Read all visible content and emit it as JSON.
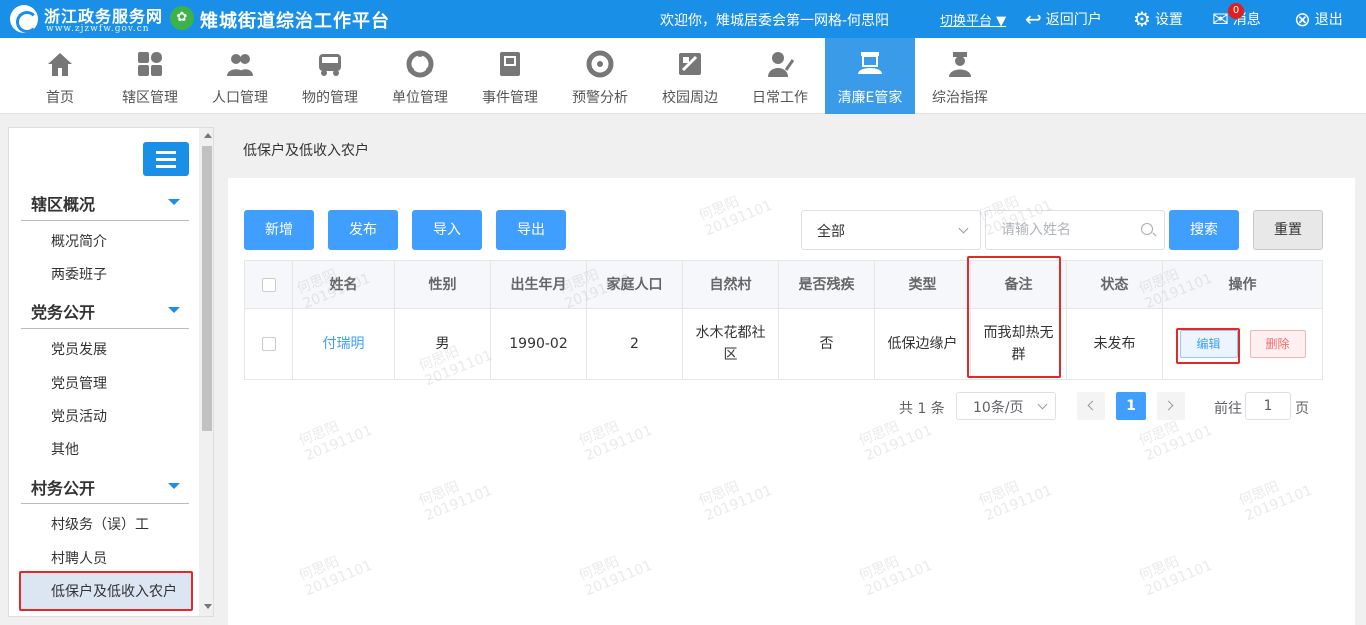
{
  "header": {
    "portal_name": "浙江政务服务网",
    "portal_url": "www.zjzwfw.gov.cn",
    "app_title": "雉城街道综治工作平台",
    "welcome": "欢迎你，雉城居委会第一网格-何思阳",
    "switch_platform": "切换平台",
    "return_portal": "返回门户",
    "settings": "设置",
    "messages": "消息",
    "message_count": "0",
    "logout": "退出"
  },
  "nav": [
    {
      "label": "首页",
      "icon": "home-icon"
    },
    {
      "label": "辖区管理",
      "icon": "grid-icon"
    },
    {
      "label": "人口管理",
      "icon": "people-icon"
    },
    {
      "label": "物的管理",
      "icon": "vehicle-icon"
    },
    {
      "label": "单位管理",
      "icon": "org-icon"
    },
    {
      "label": "事件管理",
      "icon": "book-icon"
    },
    {
      "label": "预警分析",
      "icon": "warning-icon"
    },
    {
      "label": "校园周边",
      "icon": "school-icon"
    },
    {
      "label": "日常工作",
      "icon": "worker-icon"
    },
    {
      "label": "清廉E管家",
      "icon": "manager-icon",
      "active": true
    },
    {
      "label": "综治指挥",
      "icon": "commander-icon"
    }
  ],
  "sidebar": {
    "sections": [
      {
        "title": "辖区概况",
        "items": [
          "概况简介",
          "两委班子"
        ]
      },
      {
        "title": "党务公开",
        "items": [
          "党员发展",
          "党员管理",
          "党员活动",
          "其他"
        ]
      },
      {
        "title": "村务公开",
        "items": [
          "村级务（误）工",
          "村聘人员",
          "低保户及低收入农户"
        ]
      }
    ],
    "active_item": "低保户及低收入农户"
  },
  "main": {
    "breadcrumb": "低保户及低收入农户",
    "buttons": {
      "add": "新增",
      "publish": "发布",
      "import": "导入",
      "export": "导出",
      "search": "搜索",
      "reset": "重置"
    },
    "filter_select": "全部",
    "search_placeholder": "请输入姓名",
    "table": {
      "headers": [
        "姓名",
        "性别",
        "出生年月",
        "家庭人口",
        "自然村",
        "是否残疾",
        "类型",
        "备注",
        "状态",
        "操作"
      ],
      "rows": [
        {
          "name": "付瑞明",
          "gender": "男",
          "birth": "1990-02",
          "family": "2",
          "village": "水木花都社区",
          "disabled": "否",
          "type": "低保边缘户",
          "remark": "而我却热无群",
          "status": "未发布",
          "edit": "编辑",
          "delete": "删除"
        }
      ]
    },
    "pagination": {
      "total": "共 1 条",
      "page_size": "10条/页",
      "current": "1",
      "goto_prefix": "前往",
      "goto_value": "1",
      "goto_suffix": "页"
    }
  },
  "watermark": {
    "name": "何思阳",
    "code": "20191101"
  },
  "colors": {
    "brand": "#1a8fe8",
    "primary": "#409eff",
    "highlight": "#e02a2a",
    "nav_active": "#3a9be8"
  }
}
